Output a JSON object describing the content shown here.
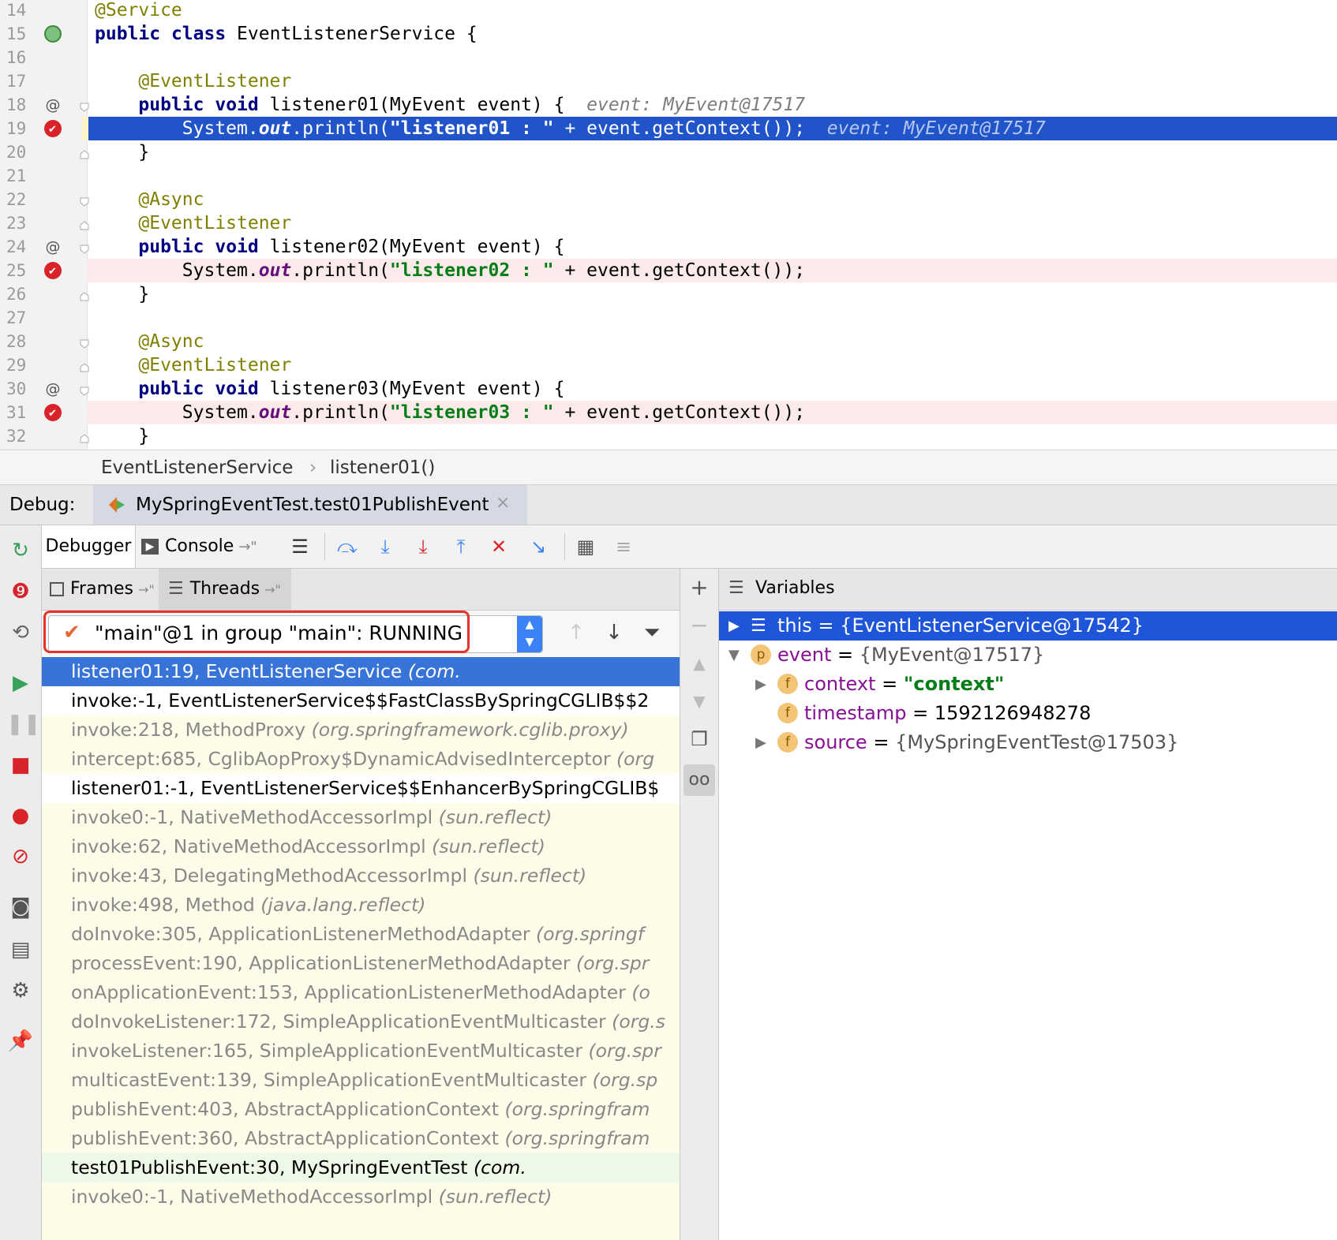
{
  "editor": {
    "lines": [
      {
        "num": "14",
        "text": "@Service"
      },
      {
        "num": "15",
        "text": "public class EventListenerService {"
      },
      {
        "num": "16",
        "text": ""
      },
      {
        "num": "17",
        "text": "    @EventListener"
      },
      {
        "num": "18",
        "text": "    public void listener01(MyEvent event) {",
        "hint": "event: MyEvent@17517"
      },
      {
        "num": "19",
        "text": "        System.out.println(\"listener01 : \" + event.getContext());",
        "hint": "event: MyEvent@17517"
      },
      {
        "num": "20",
        "text": "    }"
      },
      {
        "num": "21",
        "text": ""
      },
      {
        "num": "22",
        "text": "    @Async"
      },
      {
        "num": "23",
        "text": "    @EventListener"
      },
      {
        "num": "24",
        "text": "    public void listener02(MyEvent event) {"
      },
      {
        "num": "25",
        "text": "        System.out.println(\"listener02 : \" + event.getContext());"
      },
      {
        "num": "26",
        "text": "    }"
      },
      {
        "num": "27",
        "text": ""
      },
      {
        "num": "28",
        "text": "    @Async"
      },
      {
        "num": "29",
        "text": "    @EventListener"
      },
      {
        "num": "30",
        "text": "    public void listener03(MyEvent event) {"
      },
      {
        "num": "31",
        "text": "        System.out.println(\"listener03 : \" + event.getContext());"
      },
      {
        "num": "32",
        "text": "    }"
      }
    ]
  },
  "breadcrumb": {
    "class_name": "EventListenerService",
    "method_name": "listener01()"
  },
  "debug": {
    "label": "Debug:",
    "session_tab": "MySpringEventTest.test01PublishEvent",
    "tabs": {
      "debugger": "Debugger",
      "console": "Console"
    }
  },
  "frames": {
    "tabs": {
      "frames": "Frames",
      "threads": "Threads"
    },
    "thread_selector": "\"main\"@1 in group \"main\": RUNNING",
    "items": [
      {
        "method": "listener01:19, EventListenerService",
        "pkg": "(com.",
        "kind": "sel"
      },
      {
        "method": "invoke:-1, EventListenerService$$FastClassBySpringCGLIB$$2",
        "pkg": "",
        "kind": "user"
      },
      {
        "method": "invoke:218, MethodProxy",
        "pkg": "(org.springframework.cglib.proxy)",
        "kind": "lib"
      },
      {
        "method": "intercept:685, CglibAopProxy$DynamicAdvisedInterceptor",
        "pkg": "(org",
        "kind": "lib"
      },
      {
        "method": "listener01:-1, EventListenerService$$EnhancerBySpringCGLIB$",
        "pkg": "",
        "kind": "user"
      },
      {
        "method": "invoke0:-1, NativeMethodAccessorImpl",
        "pkg": "(sun.reflect)",
        "kind": "lib"
      },
      {
        "method": "invoke:62, NativeMethodAccessorImpl",
        "pkg": "(sun.reflect)",
        "kind": "lib"
      },
      {
        "method": "invoke:43, DelegatingMethodAccessorImpl",
        "pkg": "(sun.reflect)",
        "kind": "lib"
      },
      {
        "method": "invoke:498, Method",
        "pkg": "(java.lang.reflect)",
        "kind": "lib"
      },
      {
        "method": "doInvoke:305, ApplicationListenerMethodAdapter",
        "pkg": "(org.springf",
        "kind": "lib"
      },
      {
        "method": "processEvent:190, ApplicationListenerMethodAdapter",
        "pkg": "(org.spr",
        "kind": "lib"
      },
      {
        "method": "onApplicationEvent:153, ApplicationListenerMethodAdapter",
        "pkg": "(o",
        "kind": "lib"
      },
      {
        "method": "doInvokeListener:172, SimpleApplicationEventMulticaster",
        "pkg": "(org.s",
        "kind": "lib"
      },
      {
        "method": "invokeListener:165, SimpleApplicationEventMulticaster",
        "pkg": "(org.spr",
        "kind": "lib"
      },
      {
        "method": "multicastEvent:139, SimpleApplicationEventMulticaster",
        "pkg": "(org.sp",
        "kind": "lib"
      },
      {
        "method": "publishEvent:403, AbstractApplicationContext",
        "pkg": "(org.springfram",
        "kind": "lib"
      },
      {
        "method": "publishEvent:360, AbstractApplicationContext",
        "pkg": "(org.springfram",
        "kind": "lib"
      },
      {
        "method": "test01PublishEvent:30, MySpringEventTest",
        "pkg": "(com.",
        "kind": "test"
      },
      {
        "method": "invoke0:-1, NativeMethodAccessorImpl",
        "pkg": "(sun.reflect)",
        "kind": "lib"
      }
    ]
  },
  "variables": {
    "title": "Variables",
    "rows": [
      {
        "name": "this",
        "value": "{EventListenerService@17542}",
        "badge": "",
        "expander": "▶",
        "sel": true
      },
      {
        "name": "event",
        "value": "{MyEvent@17517}",
        "badge": "p",
        "expander": "▼"
      },
      {
        "name": "context",
        "value": "\"context\"",
        "badge": "f",
        "expander": "▶",
        "isstr": true
      },
      {
        "name": "timestamp",
        "value": "1592126948278",
        "badge": "f",
        "expander": ""
      },
      {
        "name": "source",
        "value": "{MySpringEventTest@17503}",
        "badge": "f",
        "expander": "▶"
      }
    ]
  }
}
